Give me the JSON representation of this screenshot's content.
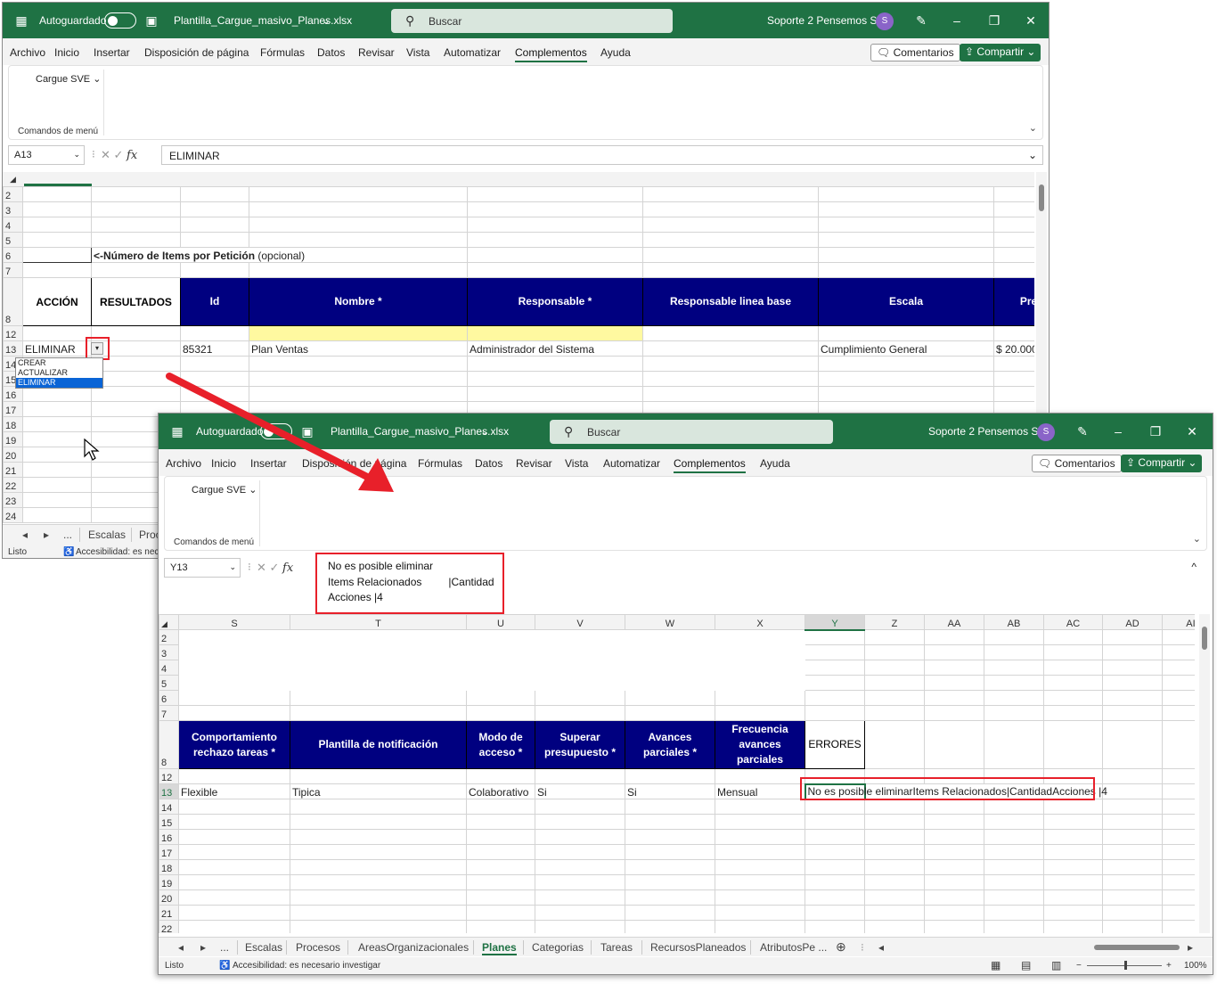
{
  "window_back": {
    "autosave_label": "Autoguardado",
    "filename": "Plantilla_Cargue_masivo_Planes.xlsx",
    "search_placeholder": "Buscar",
    "account": "Soporte 2 Pensemos S.A.",
    "avatar_letter": "S",
    "menu": [
      "Archivo",
      "Inicio",
      "Insertar",
      "Disposición de página",
      "Fórmulas",
      "Datos",
      "Revisar",
      "Vista",
      "Automatizar",
      "Complementos",
      "Ayuda"
    ],
    "active_menu": "Complementos",
    "comments_label": "Comentarios",
    "share_label": "Compartir",
    "ribbon_button": "Cargue SVE",
    "ribbon_group": "Comandos de menú",
    "name_box": "A13",
    "formula": "ELIMINAR",
    "rows": [
      "2",
      "3",
      "4",
      "5",
      "6",
      "7",
      "8",
      "12",
      "13",
      "14",
      "15",
      "16",
      "17",
      "18",
      "19",
      "20",
      "21",
      "22",
      "23",
      "24"
    ],
    "items_label_bold": "<-Número de Items por Petición",
    "items_label_normal": " (opcional)",
    "headers": [
      "ACCIÓN",
      "RESULTADOS",
      "Id",
      "Nombre *",
      "Responsable *",
      "Responsable linea base",
      "Escala",
      "Pre"
    ],
    "row13": [
      "ELIMINAR",
      "",
      "85321",
      "Plan Ventas",
      "Administrador del Sistema",
      "",
      "Cumplimiento General",
      "$ 20.000"
    ],
    "dropdown_options": [
      "CREAR",
      "ACTUALIZAR",
      "ELIMINAR"
    ],
    "dropdown_selected": "ELIMINAR",
    "sheet_tabs": [
      "Escalas",
      "Proc"
    ],
    "tab_ellipsis": "...",
    "status": "Listo",
    "accessibility": "Accesibilidad: es nece"
  },
  "window_front": {
    "autosave_label": "Autoguardado",
    "filename": "Plantilla_Cargue_masivo_Planes.xlsx",
    "search_placeholder": "Buscar",
    "account": "Soporte 2 Pensemos S.A.",
    "avatar_letter": "S",
    "menu": [
      "Archivo",
      "Inicio",
      "Insertar",
      "Disposición de página",
      "Fórmulas",
      "Datos",
      "Revisar",
      "Vista",
      "Automatizar",
      "Complementos",
      "Ayuda"
    ],
    "active_menu": "Complementos",
    "comments_label": "Comentarios",
    "share_label": "Compartir",
    "ribbon_button": "Cargue SVE",
    "ribbon_group": "Comandos de menú",
    "name_box": "Y13",
    "formula_lines": [
      "No es posible eliminar",
      "Items Relacionados         |Cantidad",
      "Acciones |4"
    ],
    "columns": [
      "S",
      "T",
      "U",
      "V",
      "W",
      "X",
      "Y",
      "Z",
      "AA",
      "AB",
      "AC",
      "AD",
      "AI"
    ],
    "rows": [
      "2",
      "3",
      "4",
      "5",
      "6",
      "7",
      "8",
      "12",
      "13",
      "14",
      "15",
      "16",
      "17",
      "18",
      "19",
      "20",
      "21",
      "22"
    ],
    "headers": [
      "Comportamiento rechazo tareas *",
      "Plantilla de notificación",
      "Modo de acceso *",
      "Superar presupuesto *",
      "Avances parciales *",
      "Frecuencia avances parciales"
    ],
    "errors_header": "ERRORES",
    "row13": [
      "Flexible",
      "Tipica",
      "Colaborativo",
      "Si",
      "Si",
      "Mensual"
    ],
    "error_value": "No es posible eliminarItems Relacionados|CantidadAcciones |4",
    "sheet_tabs": [
      "Escalas",
      "Procesos",
      "AreasOrganizacionales",
      "Planes",
      "Categorias",
      "Tareas",
      "RecursosPlaneados",
      "AtributosPe ..."
    ],
    "active_tab": "Planes",
    "tab_ellipsis": "...",
    "status": "Listo",
    "accessibility": "Accesibilidad: es necesario investigar",
    "zoom": "100%"
  },
  "colors": {
    "excel_green": "#1f7244",
    "header_navy": "#000080",
    "highlight_red": "#e8202a",
    "yellow_fill": "#fff9a0"
  }
}
